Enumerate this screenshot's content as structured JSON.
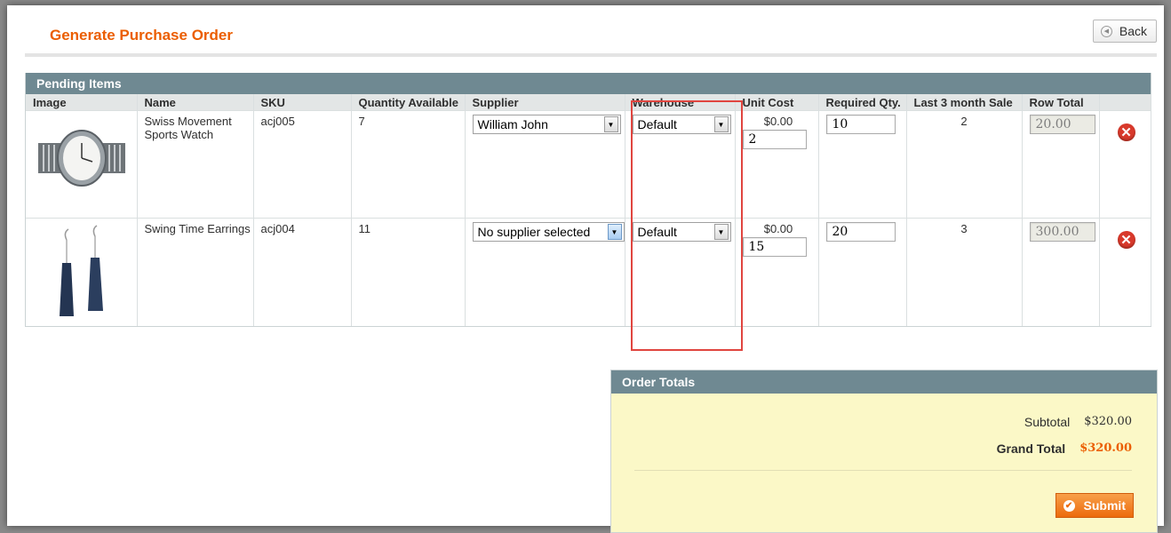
{
  "page": {
    "title": "Generate Purchase Order",
    "back_label": "Back"
  },
  "grid": {
    "title": "Pending Items",
    "columns": [
      "Image",
      "Name",
      "SKU",
      "Quantity Available",
      "Supplier",
      "Warehouse",
      "Unit Cost",
      "Required Qty.",
      "Last 3 month Sale",
      "Row Total",
      ""
    ],
    "rows": [
      {
        "image": "watch-product-image",
        "name": "Swiss Movement Sports Watch",
        "sku": "acj005",
        "qty_available": "7",
        "supplier": "William John",
        "warehouse": "Default",
        "unit_cost": "$0.00",
        "unit_cost_input": "2",
        "required_qty": "10",
        "last_3_month_sale": "2",
        "row_total": "20.00"
      },
      {
        "image": "earrings-product-image",
        "name": "Swing Time Earrings",
        "sku": "acj004",
        "qty_available": "11",
        "supplier": "No supplier selected",
        "warehouse": "Default",
        "unit_cost": "$0.00",
        "unit_cost_input": "15",
        "required_qty": "20",
        "last_3_month_sale": "3",
        "row_total": "300.00"
      }
    ]
  },
  "totals": {
    "title": "Order Totals",
    "subtotal_label": "Subtotal",
    "subtotal_value": "$320.00",
    "grand_total_label": "Grand Total",
    "grand_total_value": "$320.00",
    "submit_label": "Submit"
  },
  "colors": {
    "accent": "#eb5e00",
    "grid_header": "#6f8992",
    "totals_bg": "#fbf8c7",
    "highlight": "#e0453f",
    "delete": "#d8392b"
  }
}
